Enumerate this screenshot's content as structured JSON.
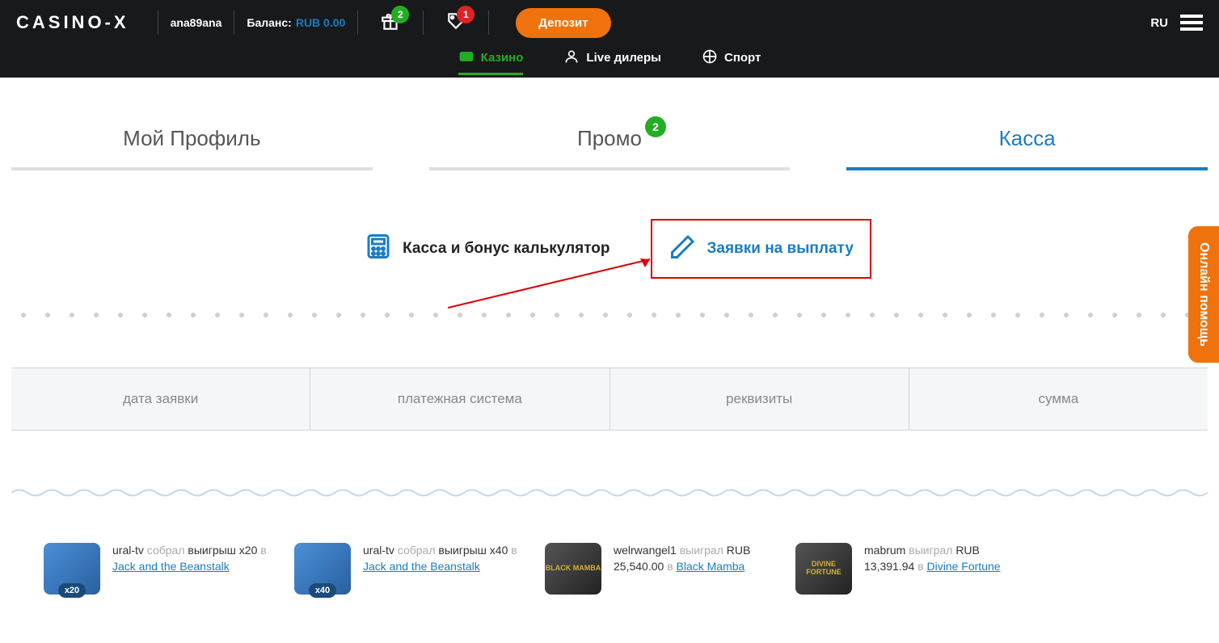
{
  "header": {
    "logo": "CASINO-X",
    "username": "ana89ana",
    "balance_label": "Баланс:",
    "balance_value": "RUB 0.00",
    "gift_badge": "2",
    "tag_badge": "1",
    "deposit_label": "Депозит",
    "lang": "RU"
  },
  "nav": {
    "casino": "Казино",
    "live": "Live дилеры",
    "sport": "Спорт"
  },
  "tabs": {
    "profile": "Мой Профиль",
    "promo": "Промо",
    "promo_badge": "2",
    "cashier": "Касса"
  },
  "subs": {
    "calc": "Касса и бонус калькулятор",
    "withdraw": "Заявки на выплату"
  },
  "table": {
    "col1": "дата заявки",
    "col2": "платежная система",
    "col3": "реквизиты",
    "col4": "сумма"
  },
  "feed": [
    {
      "user": "ural-tv",
      "verb": "собрал",
      "tail": "выигрыш x20",
      "in": "в",
      "game": "Jack and the Beanstalk",
      "mult": "x20",
      "type": "mult"
    },
    {
      "user": "ural-tv",
      "verb": "собрал",
      "tail": "выигрыш x40",
      "in": "в",
      "game": "Jack and the Beanstalk",
      "mult": "x40",
      "type": "mult"
    },
    {
      "user": "welrwangel1",
      "verb": "выиграл",
      "tail": "RUB 25,540.00",
      "in": "в",
      "game": "Black Mamba",
      "type": "game",
      "thumb": "BLACK MAMBA"
    },
    {
      "user": "mabrum",
      "verb": "выиграл",
      "tail": "RUB 13,391.94",
      "in": "в",
      "game": "Divine Fortune",
      "type": "game",
      "thumb": "DIVINE FORTUNE"
    }
  ],
  "help": "Онлайн помощь"
}
